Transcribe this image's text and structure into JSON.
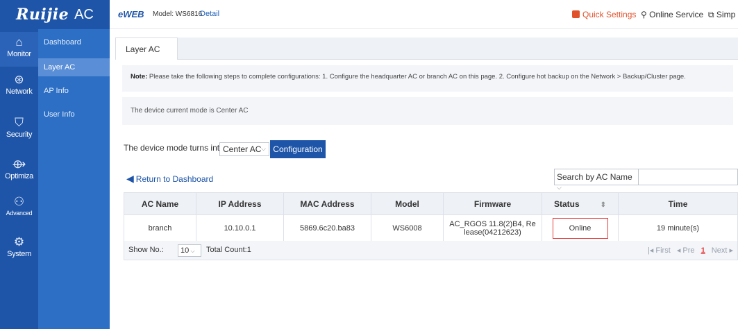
{
  "brand": {
    "logo": "Ruijie",
    "product": "AC"
  },
  "topbar": {
    "eweb": "eWEB",
    "model": "Model: WS6816",
    "detail": "Detail",
    "quick_settings": "Quick Settings",
    "online_service": "Online Service",
    "simp": "Simp"
  },
  "rail": [
    {
      "label": "Monitor",
      "icon": "home-icon",
      "glyph": "⌂"
    },
    {
      "label": "Network",
      "icon": "network-icon",
      "glyph": "⊛"
    },
    {
      "label": "Security",
      "icon": "shield-icon",
      "glyph": "⛉"
    },
    {
      "label": "Optimiza",
      "icon": "optimize-icon",
      "glyph": "⟴"
    },
    {
      "label": "Advanced",
      "icon": "users-icon",
      "glyph": "⚇"
    },
    {
      "label": "System",
      "icon": "gear-icon",
      "glyph": "⚙"
    }
  ],
  "submenu": [
    "Dashboard",
    "Layer AC",
    "AP Info",
    "User Info"
  ],
  "tab": "Layer AC",
  "note": {
    "label": "Note:",
    "text": " Please take the following steps to complete configurations: 1. Configure the headquarter AC or branch AC on this page. 2. Configure hot backup on the Network > Backup/Cluster page."
  },
  "mode_text": "The device current mode is Center AC",
  "mode_change": {
    "label": "The device mode turns into",
    "selected": "Center AC",
    "button": "Configuration"
  },
  "return_link": "Return to Dashboard",
  "search": {
    "selected": "Search by AC Name",
    "placeholder": ""
  },
  "table": {
    "columns": [
      "AC Name",
      "IP Address",
      "MAC Address",
      "Model",
      "Firmware",
      "Status",
      "Time"
    ],
    "rows": [
      {
        "ac_name": "branch",
        "ip": "10.10.0.1",
        "mac": "5869.6c20.ba83",
        "model": "WS6008",
        "firmware_line1": "AC_RGOS 11.8(2)B4, Re",
        "firmware_line2": "lease(04212623)",
        "status": "Online",
        "time": "19 minute(s)"
      }
    ]
  },
  "footer": {
    "show_label": "Show No.:",
    "page_size": "10",
    "total": "Total Count:1",
    "first": "First",
    "prev": "Pre",
    "page": "1",
    "next": "Next"
  },
  "colors": {
    "sidebar": "#1e55a8",
    "submenu": "#2c6fc4",
    "accent": "#e0522c",
    "status_border": "#e23b3b"
  }
}
